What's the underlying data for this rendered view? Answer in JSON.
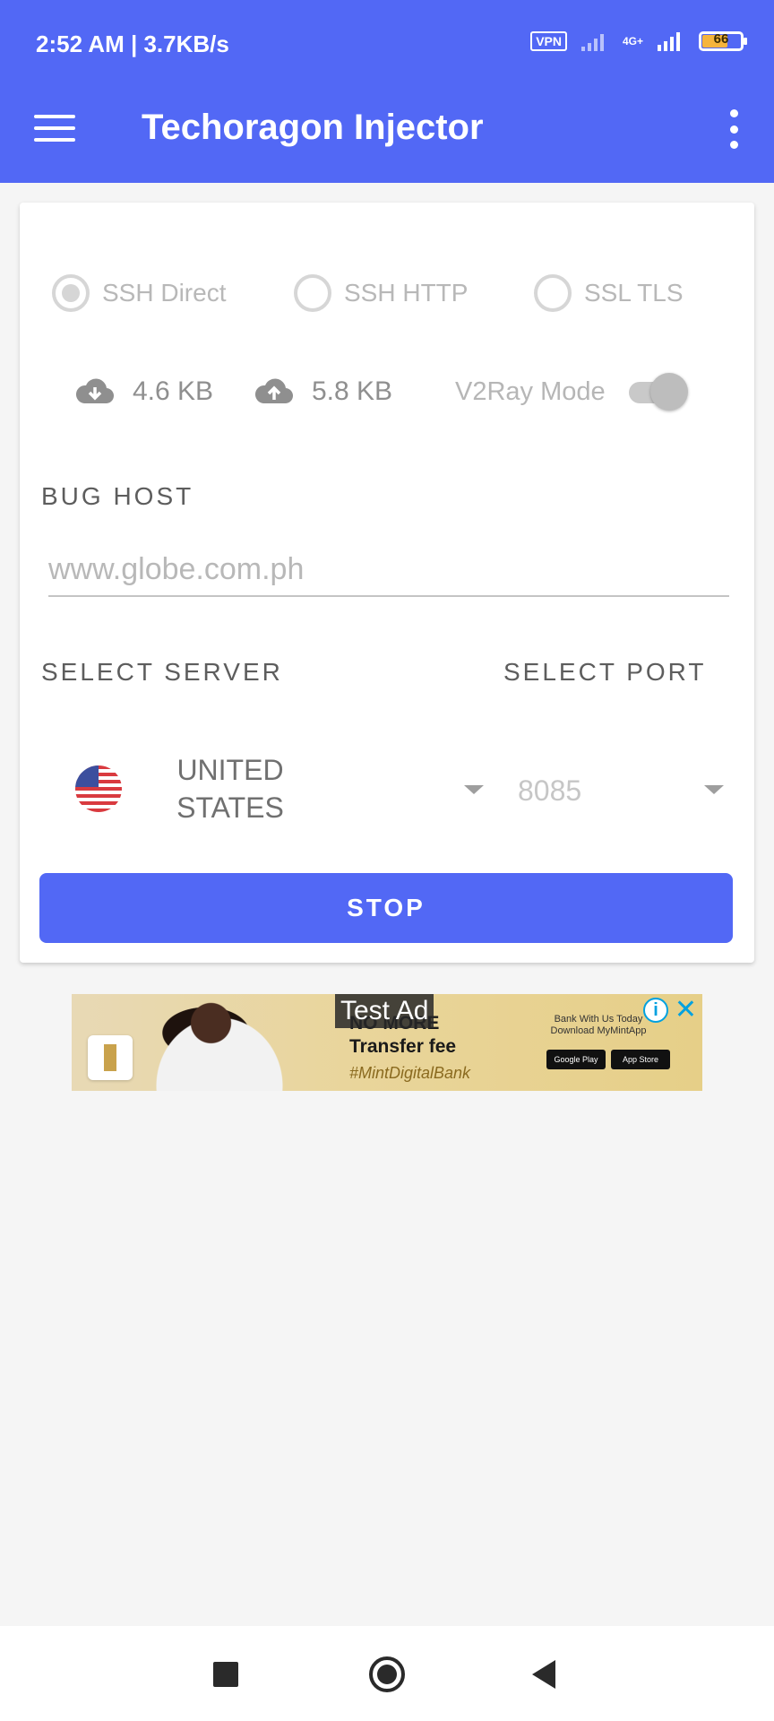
{
  "status_bar": {
    "time_speed": "2:52 AM | 3.7KB/s",
    "vpn": "VPN",
    "network": "4G+",
    "battery": "66"
  },
  "app_bar": {
    "title": "Techoragon Injector"
  },
  "mode": {
    "options": [
      "SSH Direct",
      "SSH HTTP",
      "SSL TLS"
    ],
    "selected": "SSH Direct"
  },
  "traffic": {
    "download": "4.6 KB",
    "upload": "5.8 KB",
    "v2ray_label": "V2Ray Mode",
    "v2ray_enabled": true
  },
  "bug_host": {
    "label": "BUG HOST",
    "placeholder": "www.globe.com.ph"
  },
  "server": {
    "label": "SELECT SERVER",
    "value_line1": "UNITED",
    "value_line2": "STATES"
  },
  "port": {
    "label": "SELECT PORT",
    "value": "8085"
  },
  "action": {
    "stop_label": "STOP"
  },
  "ad": {
    "test_label": "Test Ad",
    "headline_line1": "NO MORE",
    "headline_line2": "Transfer fee",
    "hashtag": "#MintDigitalBank",
    "side_text": "Bank With Us Today Download MyMintApp",
    "store1": "Google Play",
    "store2": "App Store"
  },
  "colors": {
    "primary": "#5268f5",
    "background": "#f5f5f5"
  }
}
